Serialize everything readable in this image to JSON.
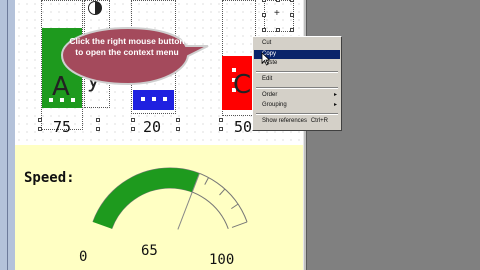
{
  "widgets": [
    {
      "letter": "A",
      "value": "75",
      "color": "#1e9a1e"
    },
    {
      "letter": "",
      "value": "20",
      "color": "#1f21e0"
    },
    {
      "letter": "C",
      "value": "50",
      "color": "#ff0000"
    }
  ],
  "callout": {
    "text": "Click the right mouse button to open the context menu",
    "color": "#a44a5c"
  },
  "context_menu": {
    "items": [
      {
        "label": "Cut",
        "highlighted": false
      },
      {
        "label": "Copy",
        "highlighted": true
      },
      {
        "label": "Paste",
        "highlighted": false
      },
      {
        "label": "Edit",
        "highlighted": false
      },
      {
        "label": "Order",
        "submenu": true
      },
      {
        "label": "Grouping",
        "submenu": true
      },
      {
        "label": "Show references",
        "shortcut": "Ctrl+R"
      }
    ]
  },
  "gauge": {
    "label": "Speed:",
    "min": 0,
    "max": 100,
    "value": 65,
    "min_label": "0",
    "max_label": "100",
    "value_label": "65",
    "color": "#1e9a1e"
  }
}
